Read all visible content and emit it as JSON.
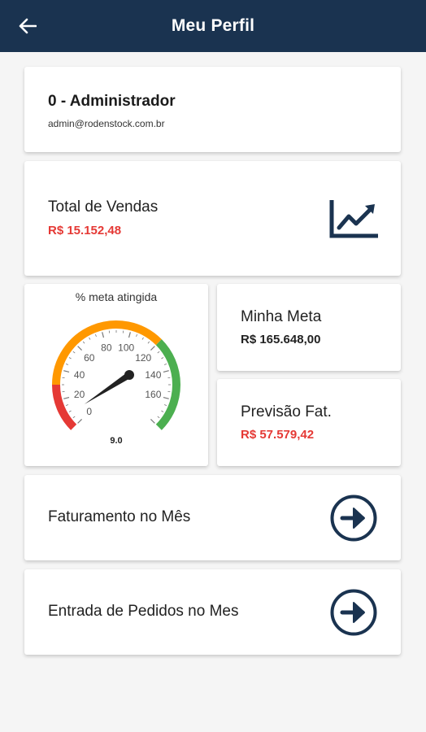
{
  "header": {
    "title": "Meu Perfil",
    "back_icon": "arrow-left-icon"
  },
  "profile": {
    "name": "0 - Administrador",
    "email": "admin@rodenstock.com.br"
  },
  "total_vendas": {
    "label": "Total de Vendas",
    "value": "R$ 15.152,48",
    "icon": "trending-up-chart-icon"
  },
  "gauge": {
    "title": "% meta atingida",
    "value": 9.0,
    "value_label": "9.0",
    "min": 0,
    "max": 180,
    "tick_labels": [
      "0",
      "20",
      "40",
      "60",
      "80",
      "100",
      "120",
      "140",
      "160"
    ],
    "bands": [
      {
        "from": 0,
        "to": 30,
        "color": "#e53935"
      },
      {
        "from": 30,
        "to": 120,
        "color": "#ff9800"
      },
      {
        "from": 120,
        "to": 180,
        "color": "#4caf50"
      }
    ]
  },
  "minha_meta": {
    "label": "Minha Meta",
    "value": "R$ 165.648,00"
  },
  "previsao": {
    "label": "Previsão Fat.",
    "value": "R$ 57.579,42"
  },
  "faturamento": {
    "label": "Faturamento no Mês",
    "icon": "arrow-right-circle-icon"
  },
  "pedidos": {
    "label": "Entrada de Pedidos no Mes",
    "icon": "arrow-right-circle-icon"
  },
  "colors": {
    "primary": "#1a3350",
    "negative": "#e53935",
    "background": "#f5f5f5"
  }
}
